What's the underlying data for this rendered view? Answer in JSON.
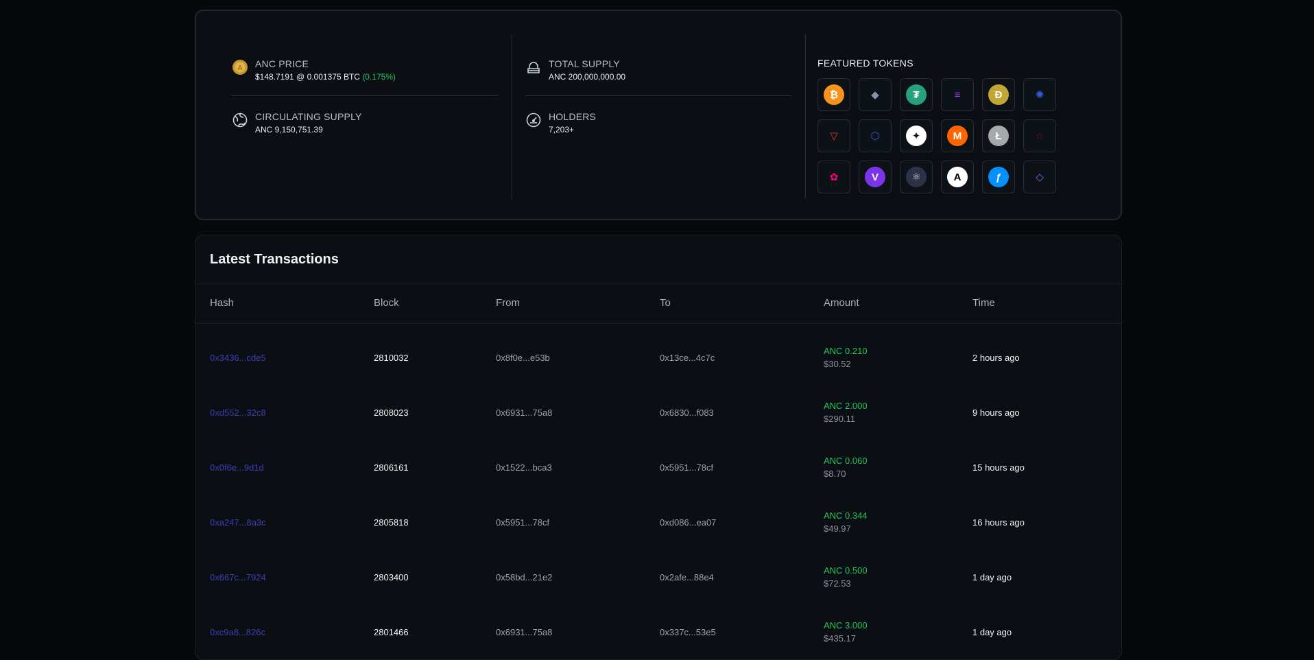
{
  "stats": {
    "anc_price": {
      "label": "ANC PRICE",
      "price": "$148.7191 @ 0.001375 BTC",
      "change": "(0.175%)"
    },
    "circulating": {
      "label": "CIRCULATING SUPPLY",
      "value": "ANC 9,150,751.39"
    },
    "total_supply": {
      "label": "TOTAL SUPPLY",
      "value": "ANC 200,000,000.00"
    },
    "holders": {
      "label": "HOLDERS",
      "value": "7,203+"
    }
  },
  "featured": {
    "title": "FEATURED TOKENS",
    "tokens": [
      {
        "name": "bitcoin-icon",
        "color": "#f7931a",
        "glyph": "₿",
        "fg": "#fff"
      },
      {
        "name": "ethereum-icon",
        "color": "transparent",
        "glyph": "◆",
        "fg": "#8a92b2"
      },
      {
        "name": "tether-icon",
        "color": "#26a17b",
        "glyph": "₮",
        "fg": "#fff"
      },
      {
        "name": "solana-icon",
        "color": "transparent",
        "glyph": "≡",
        "fg": "#9945ff"
      },
      {
        "name": "dogecoin-icon",
        "color": "#c2a633",
        "glyph": "Ð",
        "fg": "#fff"
      },
      {
        "name": "cardano-icon",
        "color": "transparent",
        "glyph": "✺",
        "fg": "#2f5fe0"
      },
      {
        "name": "tron-icon",
        "color": "transparent",
        "glyph": "▽",
        "fg": "#ef2d2d"
      },
      {
        "name": "chainlink-icon",
        "color": "transparent",
        "glyph": "⬡",
        "fg": "#375bd2"
      },
      {
        "name": "stellar-icon",
        "color": "#ffffff",
        "glyph": "✦",
        "fg": "#111"
      },
      {
        "name": "monero-icon",
        "color": "#ff6600",
        "glyph": "M",
        "fg": "#fff"
      },
      {
        "name": "litecoin-icon",
        "color": "#a6a9aa",
        "glyph": "Ł",
        "fg": "#fff"
      },
      {
        "name": "polkadot-icon",
        "color": "transparent",
        "glyph": "◌",
        "fg": "#e6007a"
      },
      {
        "name": "uniswap-icon",
        "color": "transparent",
        "glyph": "✿",
        "fg": "#ff007a"
      },
      {
        "name": "vechain-icon",
        "color": "#7b34e8",
        "glyph": "V",
        "fg": "#fff"
      },
      {
        "name": "cosmos-icon",
        "color": "#2e3148",
        "glyph": "⚛",
        "fg": "#c9cce6"
      },
      {
        "name": "algorand-icon",
        "color": "#ffffff",
        "glyph": "A",
        "fg": "#000"
      },
      {
        "name": "filecoin-icon",
        "color": "#0090ff",
        "glyph": "ƒ",
        "fg": "#fff"
      },
      {
        "name": "hedera-icon",
        "color": "transparent",
        "glyph": "◇",
        "fg": "#8b5cf6"
      }
    ]
  },
  "transactions": {
    "title": "Latest Transactions",
    "headers": {
      "hash": "Hash",
      "block": "Block",
      "from": "From",
      "to": "To",
      "amount": "Amount",
      "time": "Time"
    },
    "rows": [
      {
        "hash": "0x3436...cde5",
        "block": "2810032",
        "from": "0x8f0e...e53b",
        "to": "0x13ce...4c7c",
        "amount": "ANC 0.210",
        "usd": "$30.52",
        "time": "2 hours ago"
      },
      {
        "hash": "0xd552...32c8",
        "block": "2808023",
        "from": "0x6931...75a8",
        "to": "0x6830...f083",
        "amount": "ANC 2.000",
        "usd": "$290.11",
        "time": "9 hours ago"
      },
      {
        "hash": "0x0f6e...9d1d",
        "block": "2806161",
        "from": "0x1522...bca3",
        "to": "0x5951...78cf",
        "amount": "ANC 0.060",
        "usd": "$8.70",
        "time": "15 hours ago"
      },
      {
        "hash": "0xa247...8a3c",
        "block": "2805818",
        "from": "0x5951...78cf",
        "to": "0xd086...ea07",
        "amount": "ANC 0.344",
        "usd": "$49.97",
        "time": "16 hours ago"
      },
      {
        "hash": "0x667c...7924",
        "block": "2803400",
        "from": "0x58bd...21e2",
        "to": "0x2afe...88e4",
        "amount": "ANC 0.500",
        "usd": "$72.53",
        "time": "1 day ago"
      },
      {
        "hash": "0xc9a8...826c",
        "block": "2801466",
        "from": "0x6931...75a8",
        "to": "0x337c...53e5",
        "amount": "ANC 3.000",
        "usd": "$435.17",
        "time": "1 day ago"
      }
    ]
  }
}
